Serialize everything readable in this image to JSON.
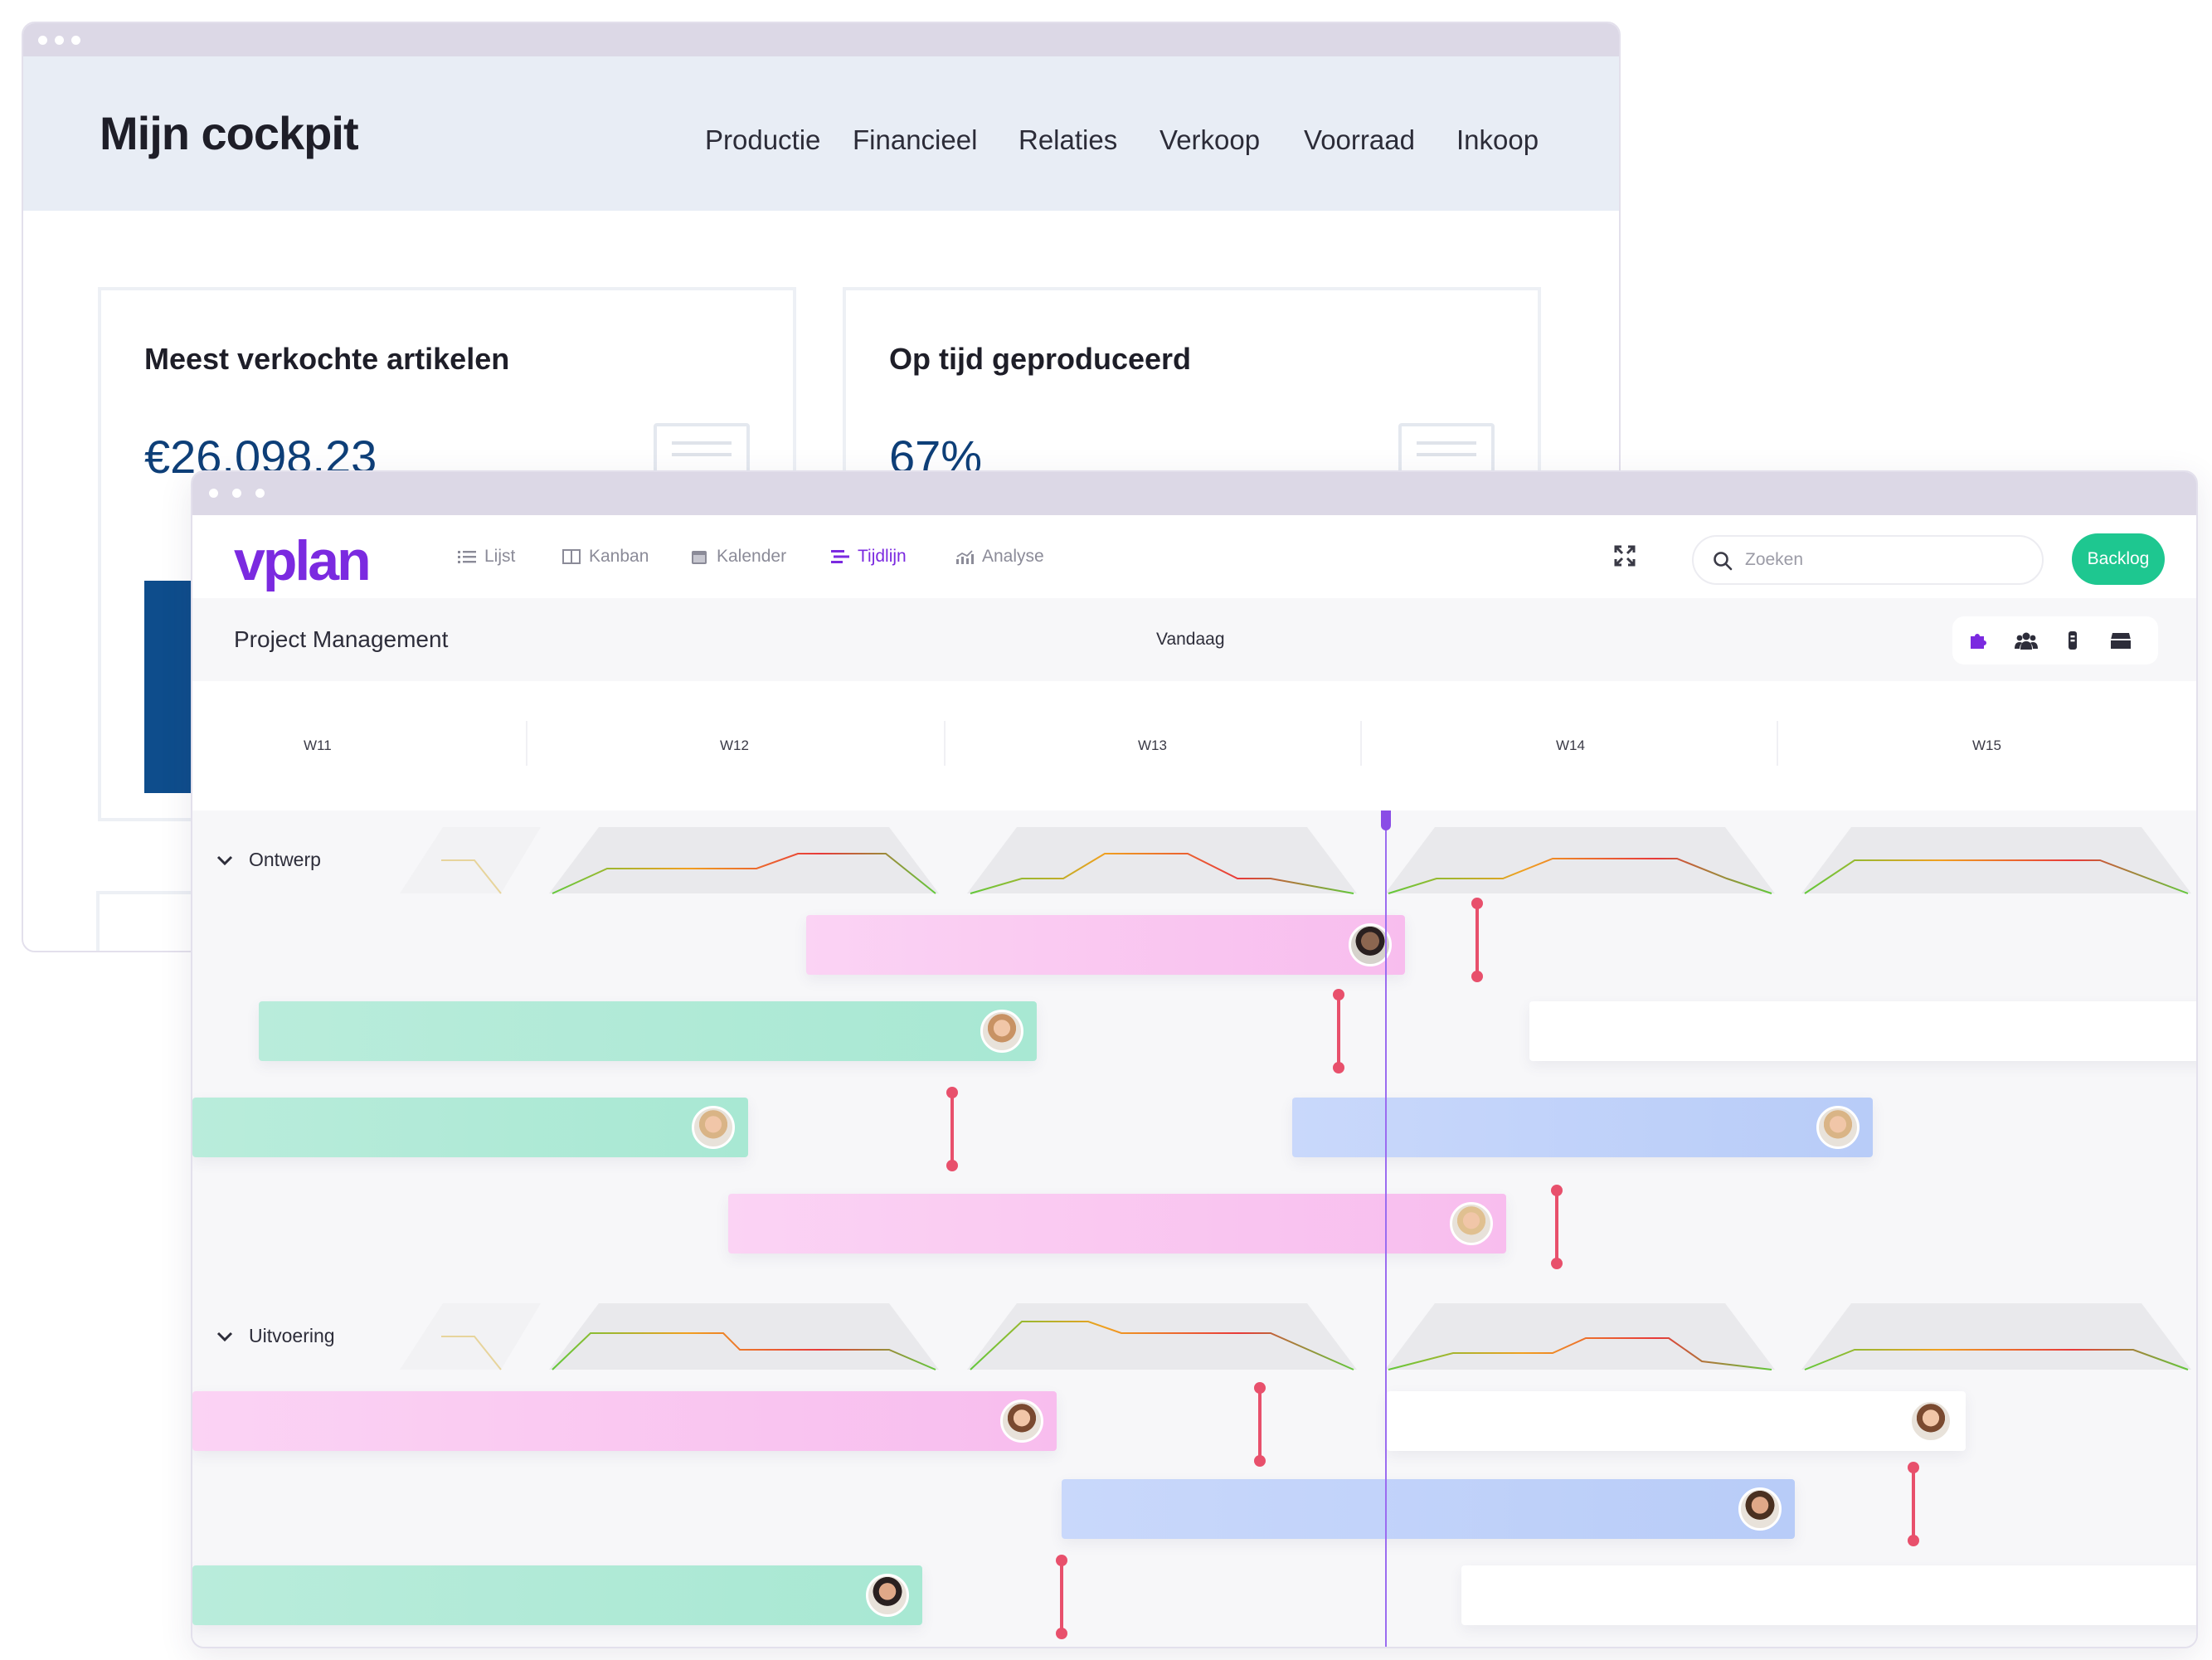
{
  "cockpit": {
    "title": "Mijn cockpit",
    "nav": [
      "Productie",
      "Financieel",
      "Relaties",
      "Verkoop",
      "Voorraad",
      "Inkoop"
    ],
    "cards": [
      {
        "title": "Meest verkochte artikelen",
        "value": "€26.098,23"
      },
      {
        "title": "Op tijd geproduceerd",
        "value": "67%"
      }
    ]
  },
  "vplan": {
    "logo": "vplan",
    "views": [
      {
        "label": "Lijst",
        "icon": "list-icon",
        "active": false
      },
      {
        "label": "Kanban",
        "icon": "kanban-icon",
        "active": false
      },
      {
        "label": "Kalender",
        "icon": "calendar-icon",
        "active": false
      },
      {
        "label": "Tijdlijn",
        "icon": "timeline-icon",
        "active": true
      },
      {
        "label": "Analyse",
        "icon": "analytics-icon",
        "active": false
      }
    ],
    "search": {
      "placeholder": "Zoeken",
      "value": ""
    },
    "backlog_label": "Backlog",
    "project_title": "Project Management",
    "today_label": "Vandaag",
    "weeks": [
      "W11",
      "W12",
      "W13",
      "W14",
      "W15"
    ],
    "groups": [
      {
        "label": "Ontwerp"
      },
      {
        "label": "Uitvoering"
      }
    ],
    "colors": {
      "accent": "#7b2ae0",
      "backlog": "#1ec790",
      "milestone": "#e8506c",
      "pink": "#f8bdee",
      "green": "#a8e8d3",
      "blue": "#b8ccf8"
    }
  }
}
